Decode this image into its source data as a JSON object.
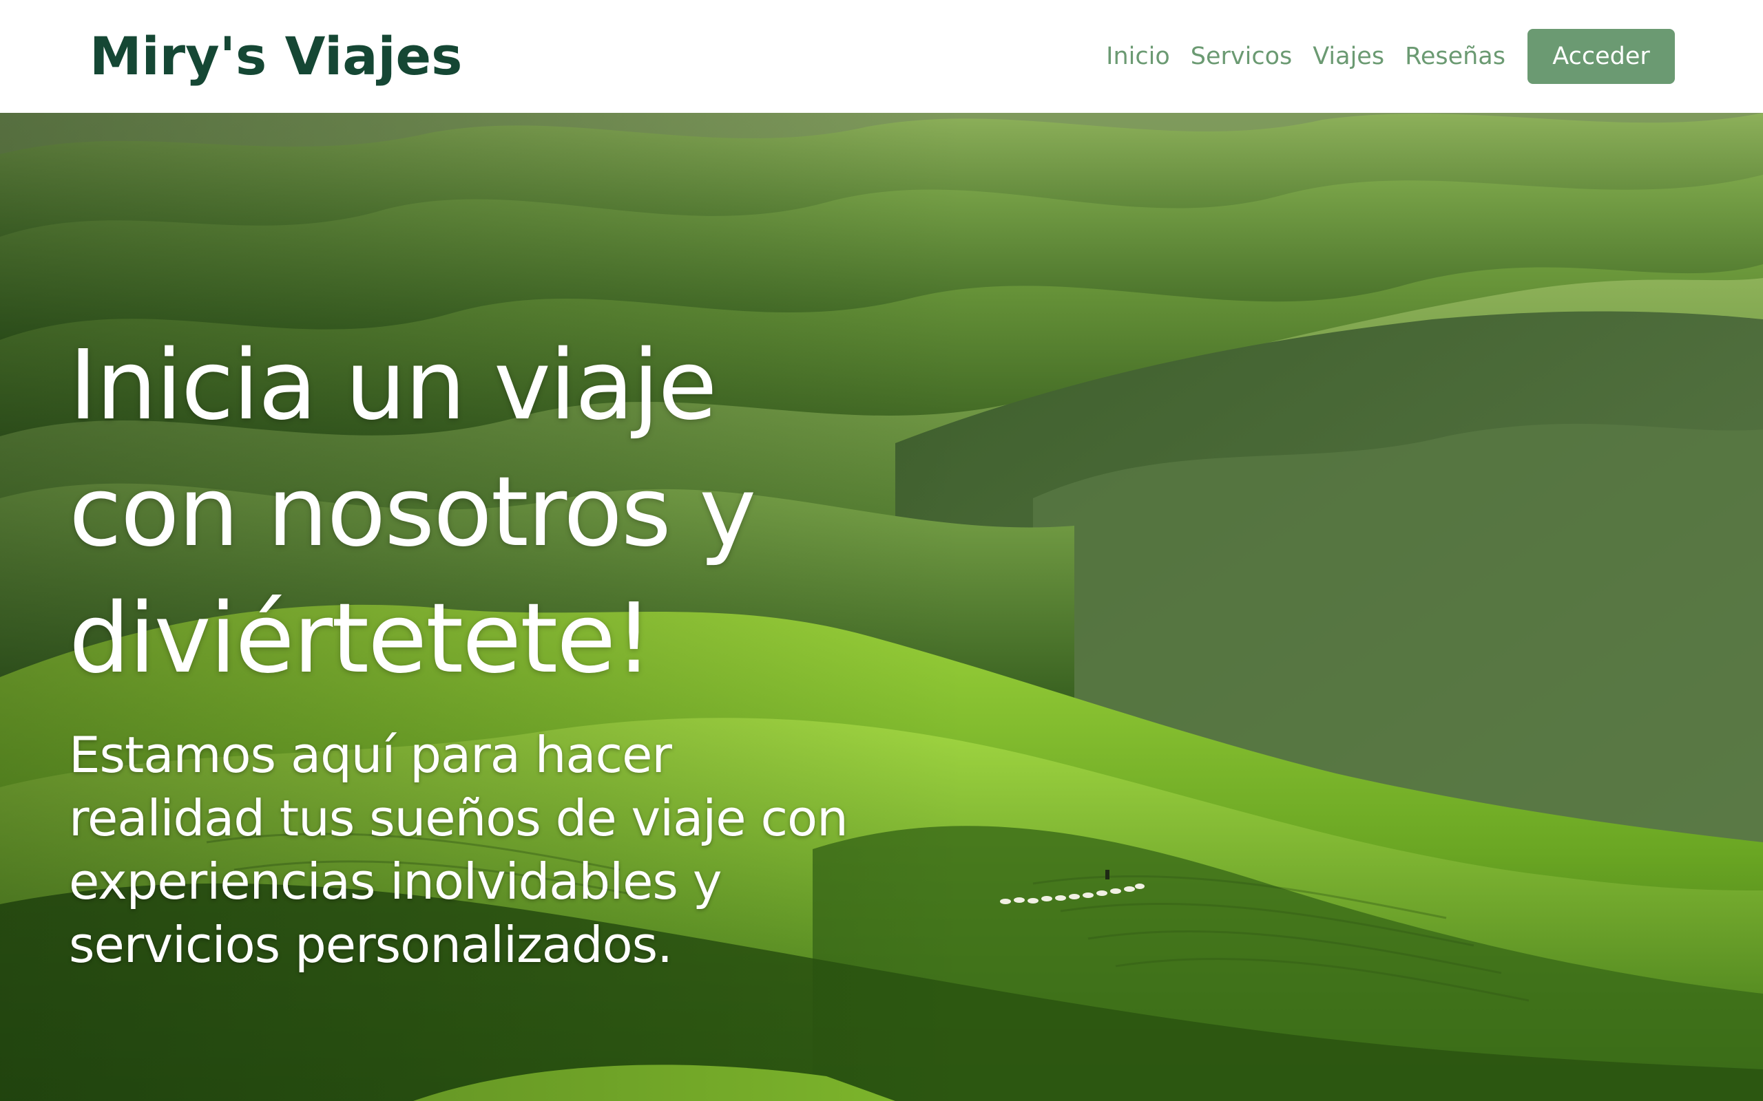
{
  "header": {
    "brand": "Miry's Viajes",
    "nav": [
      {
        "label": "Inicio"
      },
      {
        "label": "Servicos"
      },
      {
        "label": "Viajes"
      },
      {
        "label": "Reseñas"
      }
    ],
    "login_label": "Acceder"
  },
  "hero": {
    "title": "Inicia un viaje con nosotros y diviértetete!",
    "subtitle": "Estamos aquí para hacer realidad tus sueños de viaje con experiencias inolvidables y servicios personalizados.",
    "background_image": "green rolling hills landscape"
  },
  "colors": {
    "brand": "#154734",
    "accent": "#6b9a72",
    "header_bg": "#ffffff",
    "hero_text": "#ffffff"
  }
}
